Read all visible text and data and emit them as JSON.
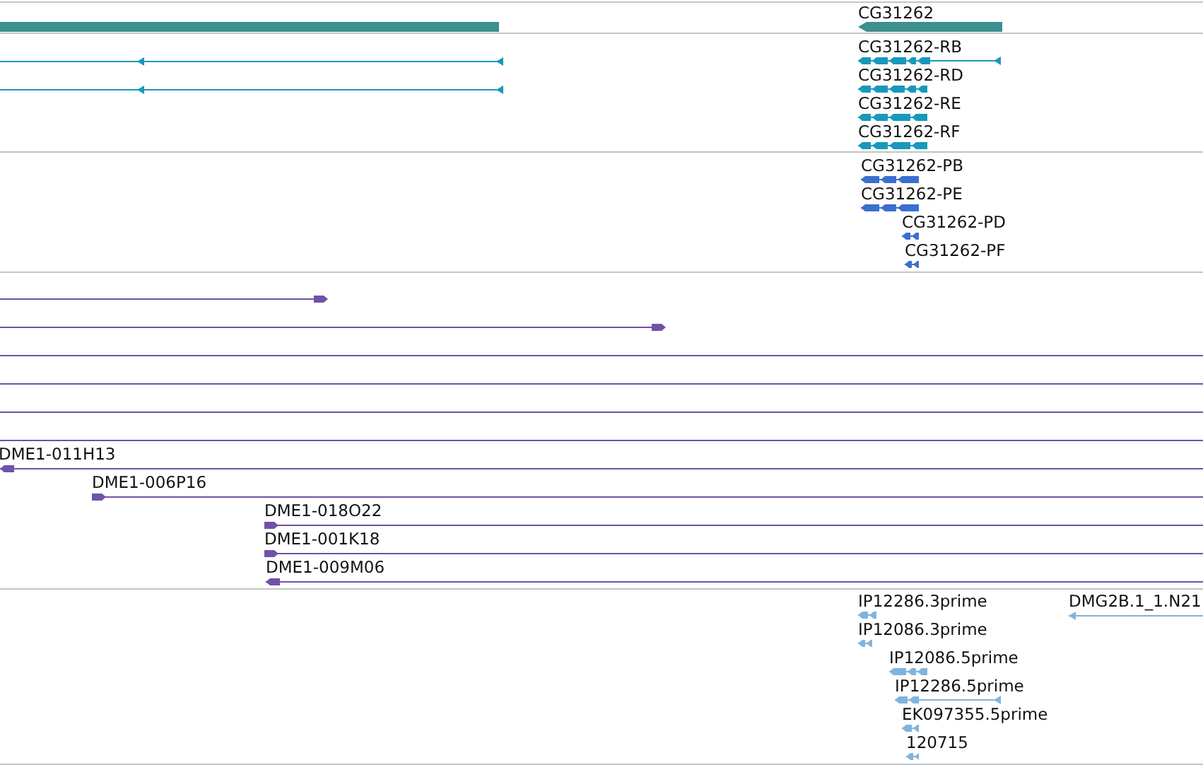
{
  "tracks": [
    {
      "color": "#3f8f8f",
      "features": [
        {
          "kind": "bar"
        },
        {
          "kind": "bar",
          "label": "CG31262",
          "reverse": true
        }
      ]
    },
    {
      "color": "#1899bb",
      "features": [
        {
          "kind": "line",
          "reverse": true
        },
        {
          "kind": "line",
          "reverse": true
        },
        {
          "kind": "exons",
          "label": "CG31262-RB",
          "reverse": true
        },
        {
          "kind": "exons",
          "label": "CG31262-RD",
          "reverse": true
        },
        {
          "kind": "exons",
          "label": "CG31262-RE",
          "reverse": true
        },
        {
          "kind": "exons",
          "label": "CG31262-RF",
          "reverse": true
        }
      ]
    },
    {
      "color": "#3a6fd0",
      "features": [
        {
          "kind": "exons",
          "label": "CG31262-PB",
          "reverse": true
        },
        {
          "kind": "exons",
          "label": "CG31262-PE",
          "reverse": true
        },
        {
          "kind": "exons",
          "label": "CG31262-PD",
          "reverse": true
        },
        {
          "kind": "exons",
          "label": "CG31262-PF",
          "reverse": true
        }
      ]
    },
    {
      "color": "#7052a8",
      "features": [
        {
          "kind": "line",
          "reverse": false
        },
        {
          "kind": "line",
          "reverse": false
        },
        {
          "kind": "line"
        },
        {
          "kind": "line"
        },
        {
          "kind": "line"
        },
        {
          "kind": "line"
        },
        {
          "kind": "line",
          "label": "DME1-011H13",
          "reverse": true
        },
        {
          "kind": "line",
          "label": "DME1-006P16",
          "reverse": false
        },
        {
          "kind": "line",
          "label": "DME1-018O22",
          "reverse": false
        },
        {
          "kind": "line",
          "label": "DME1-001K18",
          "reverse": false
        },
        {
          "kind": "line",
          "label": "DME1-009M06",
          "reverse": true
        }
      ]
    },
    {
      "color": "#80b4dc",
      "features": [
        {
          "kind": "exons",
          "label": "IP12286.3prime",
          "reverse": true
        },
        {
          "kind": "line",
          "label": "DMG2B.1_1.N21",
          "reverse": true
        },
        {
          "kind": "exons",
          "label": "IP12086.3prime",
          "reverse": true
        },
        {
          "kind": "exons",
          "label": "IP12086.5prime",
          "reverse": true
        },
        {
          "kind": "exons",
          "label": "IP12286.5prime",
          "reverse": true
        },
        {
          "kind": "exons",
          "label": "EK097355.5prime",
          "reverse": true
        },
        {
          "kind": "exons",
          "label": "120715",
          "reverse": true
        }
      ]
    }
  ]
}
